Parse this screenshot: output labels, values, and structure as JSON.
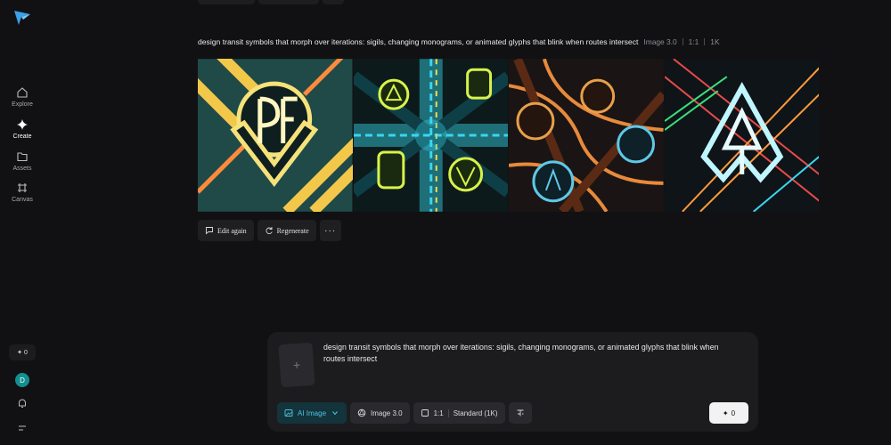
{
  "sidebar": {
    "logo": "brand-logo",
    "items": [
      {
        "label": "Explore",
        "icon": "home-icon"
      },
      {
        "label": "Create",
        "icon": "sparkle-icon"
      },
      {
        "label": "Assets",
        "icon": "folder-icon"
      },
      {
        "label": "Canvas",
        "icon": "canvas-icon"
      }
    ],
    "credits": "0",
    "avatar_letter": "D"
  },
  "generation": {
    "prompt": "design transit symbols that morph over iterations: sigils, changing monograms, or animated glyphs that blink when routes intersect",
    "model": "Image 3.0",
    "ratio": "1:1",
    "resolution": "1K",
    "actions": {
      "edit": "Edit again",
      "regenerate": "Regenerate",
      "more": "···"
    }
  },
  "composer": {
    "upload_symbol": "+",
    "text": "design transit symbols that morph over iterations: sigils, changing monograms, or animated glyphs that blink when routes intersect",
    "mode": "AI Image",
    "model": "Image 3.0",
    "ratio": "1:1",
    "quality": "Standard (1K)",
    "send_count": "0"
  },
  "colors": {
    "accent": "#4fc3e0",
    "avatar": "#138f8f",
    "background": "#111113"
  }
}
